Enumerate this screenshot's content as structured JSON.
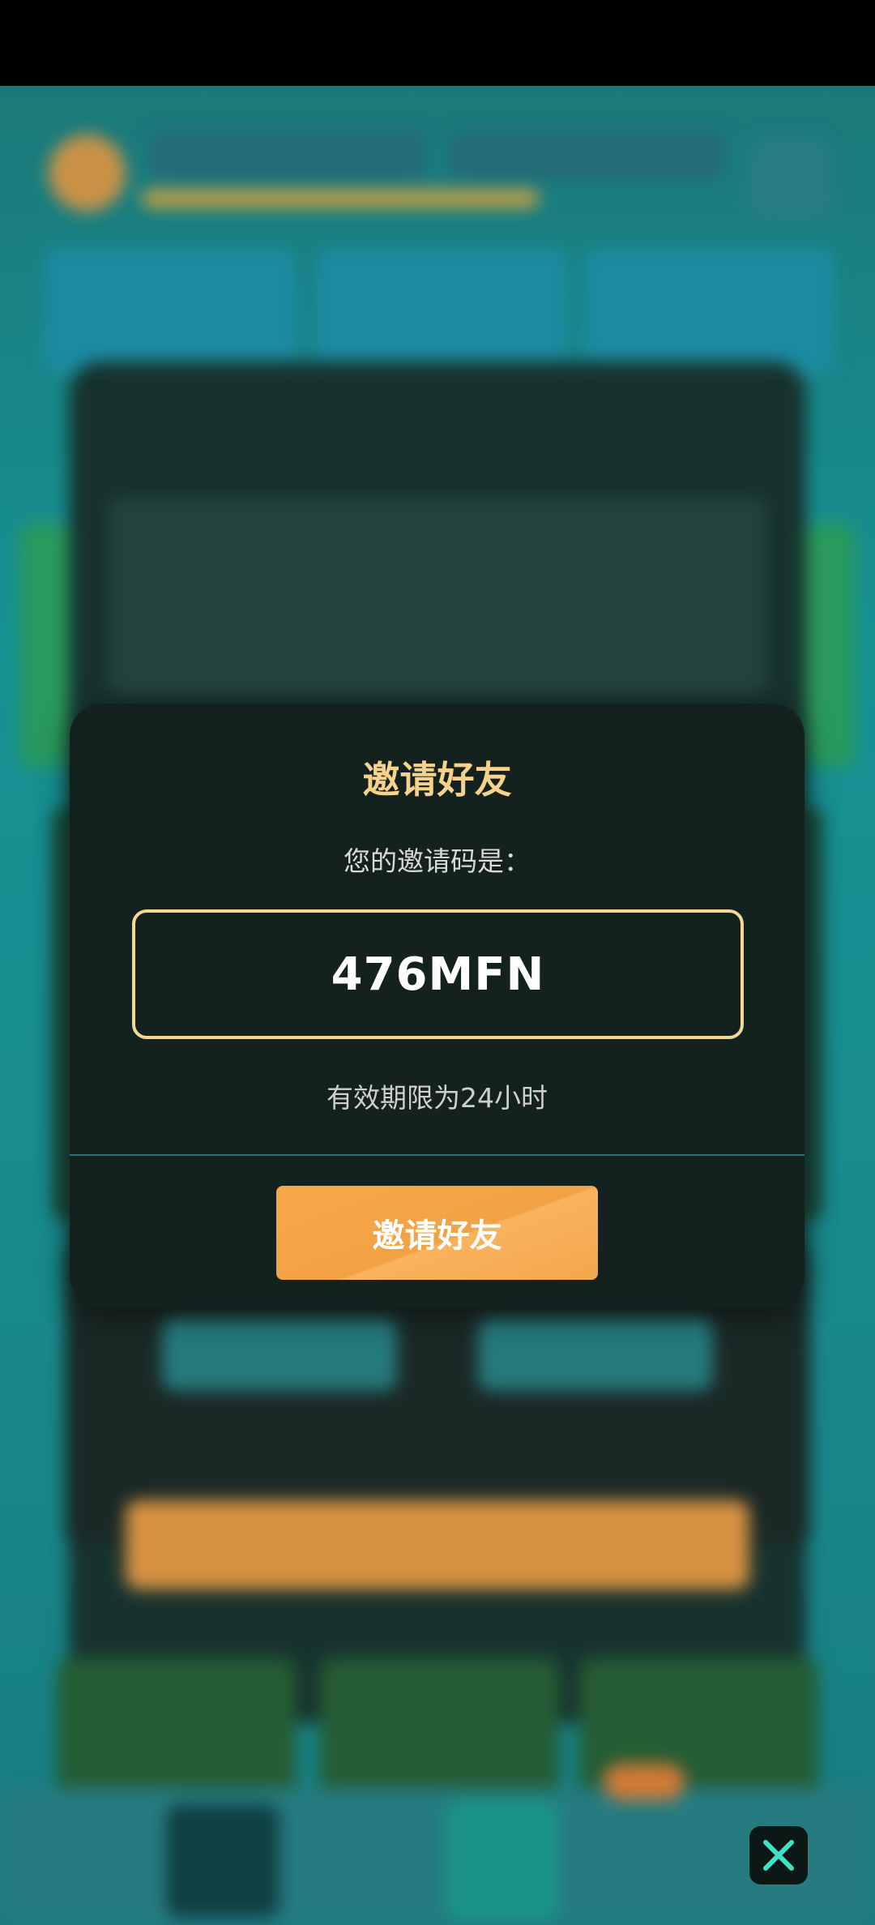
{
  "modal": {
    "title": "邀请好友",
    "subtitle": "您的邀请码是：",
    "invite_code": "476MFN",
    "validity": "有效期限为24小时",
    "button_label": "邀请好友"
  },
  "close_button": {
    "icon": "close-icon"
  },
  "colors": {
    "modal_bg": "#13211f",
    "title": "#f6d28a",
    "code_border": "#f3d793",
    "button": "#f6a649",
    "close_icon": "#3fe0c5"
  }
}
